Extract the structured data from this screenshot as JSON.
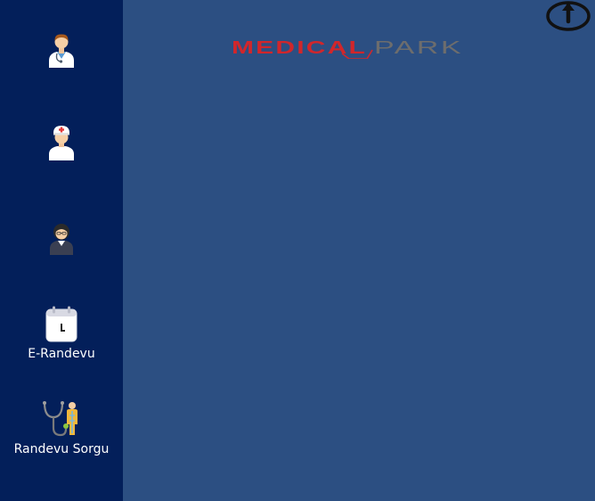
{
  "sidebar": {
    "items": [
      {
        "icon": "male-doctor-icon",
        "label": ""
      },
      {
        "icon": "nurse-icon",
        "label": ""
      },
      {
        "icon": "female-staff-icon",
        "label": ""
      },
      {
        "icon": "calendar-clock-icon",
        "label": "E-Randevu"
      },
      {
        "icon": "stethoscope-patient-icon",
        "label": "Randevu Sorgu"
      }
    ]
  },
  "header": {
    "logo": {
      "part1": "MEDICAL",
      "part2": "PARK"
    },
    "power_icon": "power-icon"
  },
  "colors": {
    "sidebar_bg": "#031f5a",
    "main_bg": "#2c4f82",
    "logo_red": "#d1262b",
    "logo_gray": "#6d6d6d"
  }
}
